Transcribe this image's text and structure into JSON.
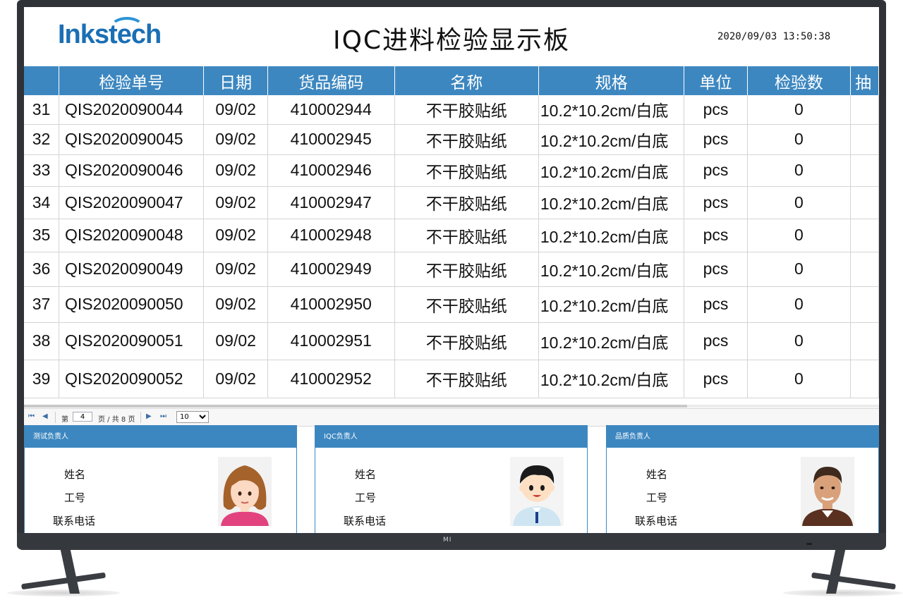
{
  "header": {
    "logo_text": "Inkstech",
    "title": "IQC进料检验显示板",
    "datetime": "2020/09/03 13:50:38"
  },
  "tv": {
    "brand": "MI"
  },
  "table": {
    "columns": [
      "",
      "检验单号",
      "日期",
      "货品编码",
      "名称",
      "规格",
      "单位",
      "检验数",
      "抽"
    ],
    "rows": [
      [
        "31",
        "QIS2020090044",
        "09/02",
        "410002944",
        "不干胶贴纸",
        "10.2*10.2cm/白底",
        "pcs",
        "0"
      ],
      [
        "32",
        "QIS2020090045",
        "09/02",
        "410002945",
        "不干胶贴纸",
        "10.2*10.2cm/白底",
        "pcs",
        "0"
      ],
      [
        "33",
        "QIS2020090046",
        "09/02",
        "410002946",
        "不干胶贴纸",
        "10.2*10.2cm/白底",
        "pcs",
        "0"
      ],
      [
        "34",
        "QIS2020090047",
        "09/02",
        "410002947",
        "不干胶贴纸",
        "10.2*10.2cm/白底",
        "pcs",
        "0"
      ],
      [
        "35",
        "QIS2020090048",
        "09/02",
        "410002948",
        "不干胶贴纸",
        "10.2*10.2cm/白底",
        "pcs",
        "0"
      ],
      [
        "36",
        "QIS2020090049",
        "09/02",
        "410002949",
        "不干胶贴纸",
        "10.2*10.2cm/白底",
        "pcs",
        "0"
      ],
      [
        "37",
        "QIS2020090050",
        "09/02",
        "410002950",
        "不干胶贴纸",
        "10.2*10.2cm/白底",
        "pcs",
        "0"
      ],
      [
        "38",
        "QIS2020090051",
        "09/02",
        "410002951",
        "不干胶贴纸",
        "10.2*10.2cm/白底",
        "pcs",
        "0"
      ],
      [
        "39",
        "QIS2020090052",
        "09/02",
        "410002952",
        "不干胶贴纸",
        "10.2*10.2cm/白底",
        "pcs",
        "0"
      ]
    ]
  },
  "pager": {
    "first_icon": "first-page-icon",
    "prev_icon": "prev-page-icon",
    "next_icon": "next-page-icon",
    "last_icon": "last-page-icon",
    "page_prefix": "第",
    "page_value": "4",
    "page_suffix": "页 / 共 8 页",
    "page_size": "10"
  },
  "cards": [
    {
      "title": "测试负责人",
      "name_label": "姓名",
      "id_label": "工号",
      "phone_label": "联系电话",
      "avatar": "female-avatar"
    },
    {
      "title": "IQC负责人",
      "name_label": "姓名",
      "id_label": "工号",
      "phone_label": "联系电话",
      "avatar": "cartoon-boy-avatar"
    },
    {
      "title": "品质负责人",
      "name_label": "姓名",
      "id_label": "工号",
      "phone_label": "联系电话",
      "avatar": "male-avatar"
    }
  ],
  "colors": {
    "header_blue": "#3d87c0",
    "logo_blue": "#1b6fb4",
    "bezel": "#2f3236"
  }
}
